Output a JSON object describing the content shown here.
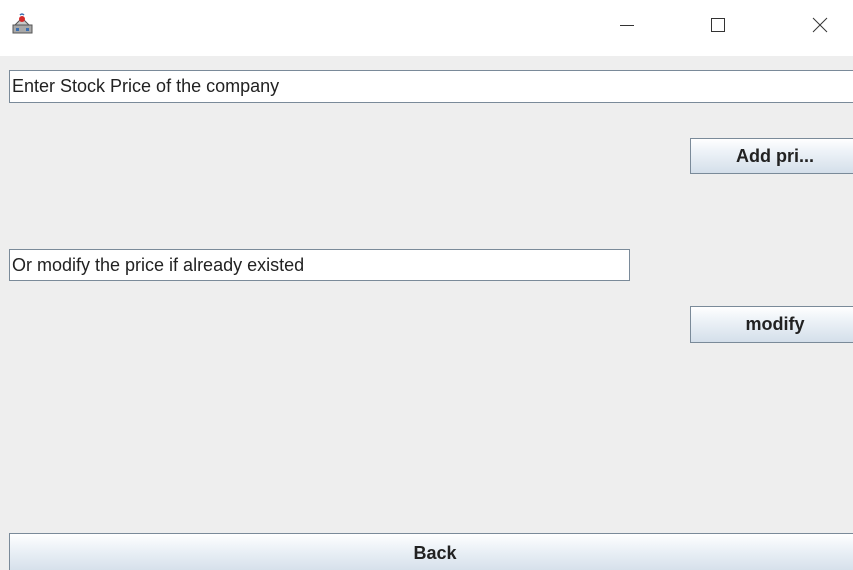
{
  "window": {
    "app_icon": "java-cup-icon",
    "controls": {
      "minimize_icon": "minimize-icon",
      "maximize_icon": "maximize-icon",
      "close_icon": "close-icon"
    }
  },
  "form": {
    "stock_price_field": {
      "value": "Enter Stock Price of the company"
    },
    "add_price_button": {
      "label": "Add pri..."
    },
    "modify_price_field": {
      "value": "Or modify the price if already existed"
    },
    "modify_button": {
      "label": "modify"
    },
    "back_button": {
      "label": "Back"
    }
  }
}
